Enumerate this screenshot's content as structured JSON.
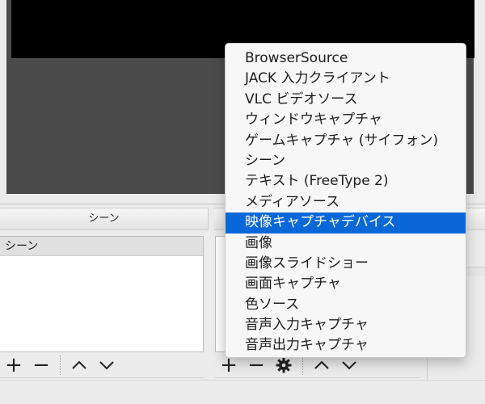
{
  "docks": {
    "scenes_title": "シーン",
    "sources_title": "",
    "mixer_title": ""
  },
  "scenes": {
    "items": [
      "シーン"
    ]
  },
  "menu": {
    "items": [
      "BrowserSource",
      "JACK 入力クライアント",
      "VLC ビデオソース",
      "ウィンドウキャプチャ",
      "ゲームキャプチャ (サイフォン)",
      "シーン",
      "テキスト (FreeType 2)",
      "メディアソース",
      "映像キャプチャデバイス",
      "画像",
      "画像スライドショー",
      "画面キャプチャ",
      "色ソース",
      "音声入力キャプチャ",
      "音声出力キャプチャ"
    ],
    "selected_index": 8
  },
  "toolbar": {
    "add_label": "+",
    "remove_label": "−"
  },
  "colors": {
    "selection": "#0a67d8",
    "preview_bg": "#4b4b4b"
  }
}
